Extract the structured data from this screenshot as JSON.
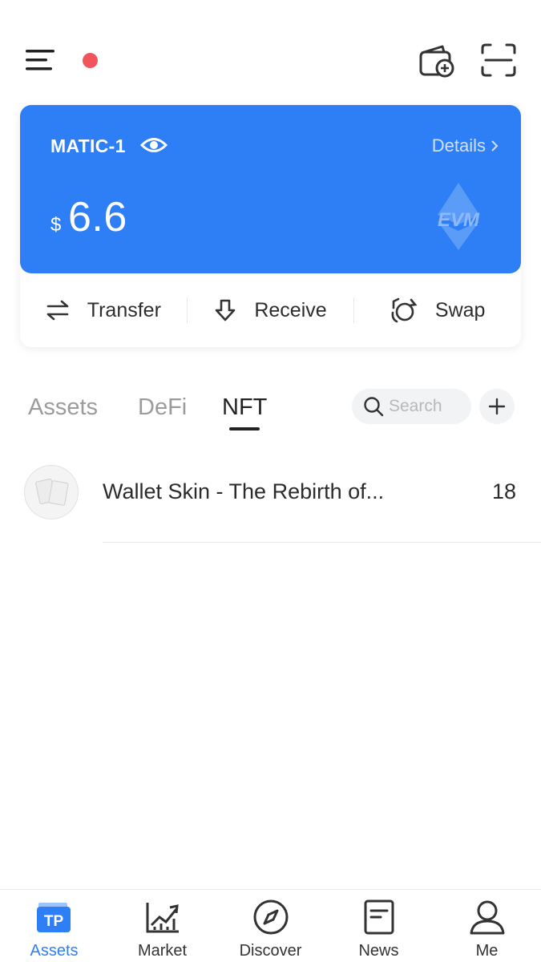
{
  "wallet": {
    "name": "MATIC-1",
    "details_label": "Details",
    "currency_symbol": "$",
    "balance": "6.6",
    "network_logo_text": "EVM"
  },
  "actions": [
    {
      "label": "Transfer",
      "icon": "transfer-icon"
    },
    {
      "label": "Receive",
      "icon": "receive-icon"
    },
    {
      "label": "Swap",
      "icon": "swap-icon"
    }
  ],
  "tabs": [
    {
      "label": "Assets",
      "active": false
    },
    {
      "label": "DeFi",
      "active": false
    },
    {
      "label": "NFT",
      "active": true
    }
  ],
  "search": {
    "placeholder": "Search",
    "value": ""
  },
  "nft_items": [
    {
      "name": "Wallet Skin - The Rebirth of...",
      "count": "18"
    }
  ],
  "bottom_nav": [
    {
      "label": "Assets",
      "icon": "tp-logo-icon",
      "active": true
    },
    {
      "label": "Market",
      "icon": "market-chart-icon",
      "active": false
    },
    {
      "label": "Discover",
      "icon": "compass-icon",
      "active": false
    },
    {
      "label": "News",
      "icon": "news-icon",
      "active": false
    },
    {
      "label": "Me",
      "icon": "person-icon",
      "active": false
    }
  ],
  "colors": {
    "accent": "#2e7ff6",
    "notification_dot": "#f2545b",
    "inactive_tab": "#9b9b9b"
  }
}
